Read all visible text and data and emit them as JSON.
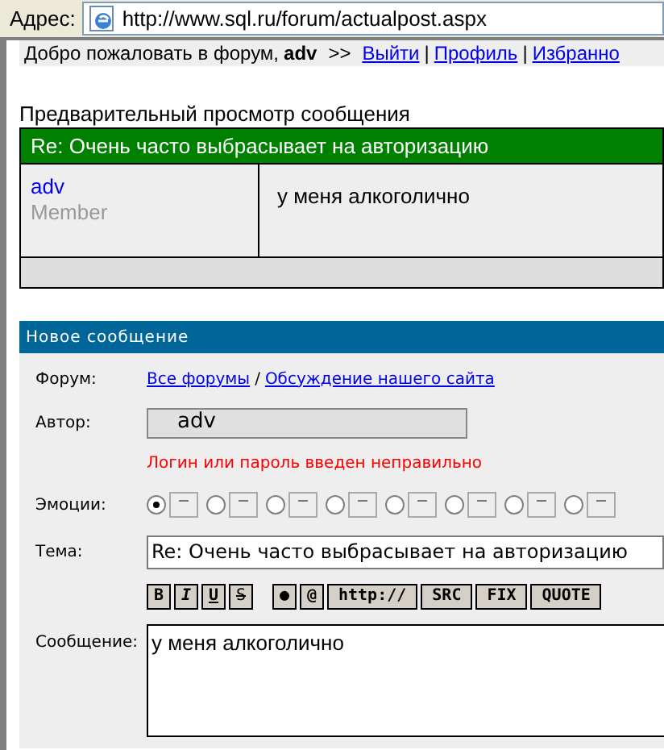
{
  "address_bar": {
    "label": "Адрес:",
    "url": "http://www.sql.ru/forum/actualpost.aspx"
  },
  "welcome": {
    "text": "Добро пожаловать в форум,",
    "user": "adv",
    "separator": ">>",
    "link_separator": "|",
    "links": [
      "Выйти",
      "Профиль",
      "Избранно"
    ]
  },
  "preview": {
    "title": "Предварительный просмотр сообщения",
    "header": "Re: Очень часто выбрасывает на авторизацию",
    "author": "adv",
    "rank": "Member",
    "body": "у меня алкоголично"
  },
  "new_message": {
    "title": "Новое сообщение",
    "forum_label": "Форум:",
    "forum_links": [
      "Все форумы",
      "Обсуждение нашего сайта"
    ],
    "forum_separator": "/",
    "author_label": "Автор:",
    "author_value": "adv",
    "error": "Логин или пароль введен неправильно",
    "emotions_label": "Эмоции:",
    "emotions": [
      {
        "selected": true
      },
      {
        "selected": false
      },
      {
        "selected": false
      },
      {
        "selected": false
      },
      {
        "selected": false
      },
      {
        "selected": false
      },
      {
        "selected": false
      },
      {
        "selected": false
      }
    ],
    "subject_label": "Тема:",
    "subject_value": "Re: Очень часто выбрасывает на авторизацию",
    "toolbar": [
      {
        "label": "B",
        "kind": "bold"
      },
      {
        "label": "I",
        "kind": "italic"
      },
      {
        "label": "U",
        "kind": "underline"
      },
      {
        "label": "S",
        "kind": "strike"
      },
      {
        "label": "●",
        "kind": "plain"
      },
      {
        "label": "@",
        "kind": "plain"
      },
      {
        "label": "http://",
        "kind": "plain"
      },
      {
        "label": "SRC",
        "kind": "plain"
      },
      {
        "label": "FIX",
        "kind": "plain"
      },
      {
        "label": "QUOTE",
        "kind": "plain"
      }
    ],
    "message_label": "Сообщение:",
    "message_value": "у меня алкоголично"
  }
}
